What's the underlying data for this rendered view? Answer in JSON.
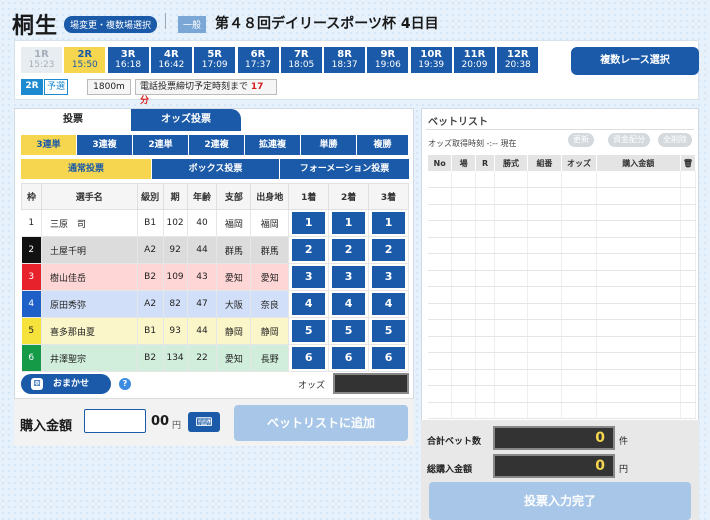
{
  "header": {
    "venue": "桐生",
    "change_pill": "場変更・複数場選択",
    "grade": "一般",
    "race_title": "第４８回デイリースポーツ杯 4日目"
  },
  "races": [
    {
      "r": "1R",
      "time": "15:23",
      "state": "past"
    },
    {
      "r": "2R",
      "time": "15:50",
      "state": "sel"
    },
    {
      "r": "3R",
      "time": "16:18",
      "state": ""
    },
    {
      "r": "4R",
      "time": "16:42",
      "state": ""
    },
    {
      "r": "5R",
      "time": "17:09",
      "state": ""
    },
    {
      "r": "6R",
      "time": "17:37",
      "state": ""
    },
    {
      "r": "7R",
      "time": "18:05",
      "state": ""
    },
    {
      "r": "8R",
      "time": "18:37",
      "state": ""
    },
    {
      "r": "9R",
      "time": "19:06",
      "state": ""
    },
    {
      "r": "10R",
      "time": "19:39",
      "state": ""
    },
    {
      "r": "11R",
      "time": "20:09",
      "state": ""
    },
    {
      "r": "12R",
      "time": "20:38",
      "state": ""
    }
  ],
  "multi_race": "複数レース選択",
  "race_info": {
    "race": "2R",
    "type": "予選",
    "distance": "1800m",
    "cutoff_label": "電話投票締切予定時刻まで",
    "cutoff_value": "17分"
  },
  "tabs": {
    "vote": "投票",
    "odds": "オッズ投票"
  },
  "bet_types": [
    {
      "label": "3連単",
      "sel": true
    },
    {
      "label": "3連複",
      "sel": false
    },
    {
      "label": "2連単",
      "sel": false
    },
    {
      "label": "2連複",
      "sel": false
    },
    {
      "label": "拡連複",
      "sel": false
    },
    {
      "label": "単勝",
      "sel": false
    },
    {
      "label": "複勝",
      "sel": false
    }
  ],
  "modes": [
    {
      "label": "通常投票",
      "sel": true
    },
    {
      "label": "ボックス投票",
      "sel": false
    },
    {
      "label": "フォーメーション投票",
      "sel": false
    }
  ],
  "table_headers": [
    "枠",
    "選手名",
    "級別",
    "期",
    "年齢",
    "支部",
    "出身地",
    "1着",
    "2着",
    "3着"
  ],
  "racers": [
    {
      "w": "1",
      "name": "三原　司",
      "cls": "B1",
      "ki": "102",
      "age": "40",
      "br": "福岡",
      "home": "福岡",
      "fav": false
    },
    {
      "w": "2",
      "name": "土屋千明",
      "cls": "A2",
      "ki": "92",
      "age": "44",
      "br": "群馬",
      "home": "群馬",
      "fav": true
    },
    {
      "w": "3",
      "name": "樹山佳岳",
      "cls": "B2",
      "ki": "109",
      "age": "43",
      "br": "愛知",
      "home": "愛知",
      "fav": false
    },
    {
      "w": "4",
      "name": "原田秀弥",
      "cls": "A2",
      "ki": "82",
      "age": "47",
      "br": "大阪",
      "home": "奈良",
      "fav": false
    },
    {
      "w": "5",
      "name": "喜多那由夏",
      "cls": "B1",
      "ki": "93",
      "age": "44",
      "br": "静岡",
      "home": "静岡",
      "fav": true
    },
    {
      "w": "6",
      "name": "井澤聖宗",
      "cls": "B2",
      "ki": "134",
      "age": "22",
      "br": "愛知",
      "home": "長野",
      "fav": true
    }
  ],
  "frame_colors": [
    {
      "bg": "#ffffff",
      "fg": "#222222",
      "row": "#ffffff"
    },
    {
      "bg": "#111111",
      "fg": "#ffffff",
      "row": "#dcdcdc"
    },
    {
      "bg": "#e8222c",
      "fg": "#ffffff",
      "row": "#ffd6d6"
    },
    {
      "bg": "#1f5fc8",
      "fg": "#ffffff",
      "row": "#d2dff8"
    },
    {
      "bg": "#f5e23a",
      "fg": "#222222",
      "row": "#fbf6c9"
    },
    {
      "bg": "#159a48",
      "fg": "#ffffff",
      "row": "#d0eedb"
    }
  ],
  "omakase": "おまかせ",
  "help": "?",
  "odds_label": "オッズ",
  "purchase": {
    "label": "購入金額",
    "value": "00",
    "unit": "円",
    "add_button": "ベットリストに追加"
  },
  "betlist": {
    "title": "ベットリスト",
    "odds_time": "オッズ取得時刻 -:-- 現在",
    "btn_update": "更新",
    "btn_alloc": "資金配分",
    "btn_delete": "全削除",
    "headers": [
      "No",
      "場",
      "R",
      "勝式",
      "組番",
      "オッズ",
      "購入金額",
      "🗑"
    ]
  },
  "totals": {
    "bets_label": "合計ベット数",
    "bets_value": "0",
    "bets_unit": "件",
    "amount_label": "総購入金額",
    "amount_value": "0",
    "amount_unit": "円",
    "done_button": "投票入力完了"
  }
}
